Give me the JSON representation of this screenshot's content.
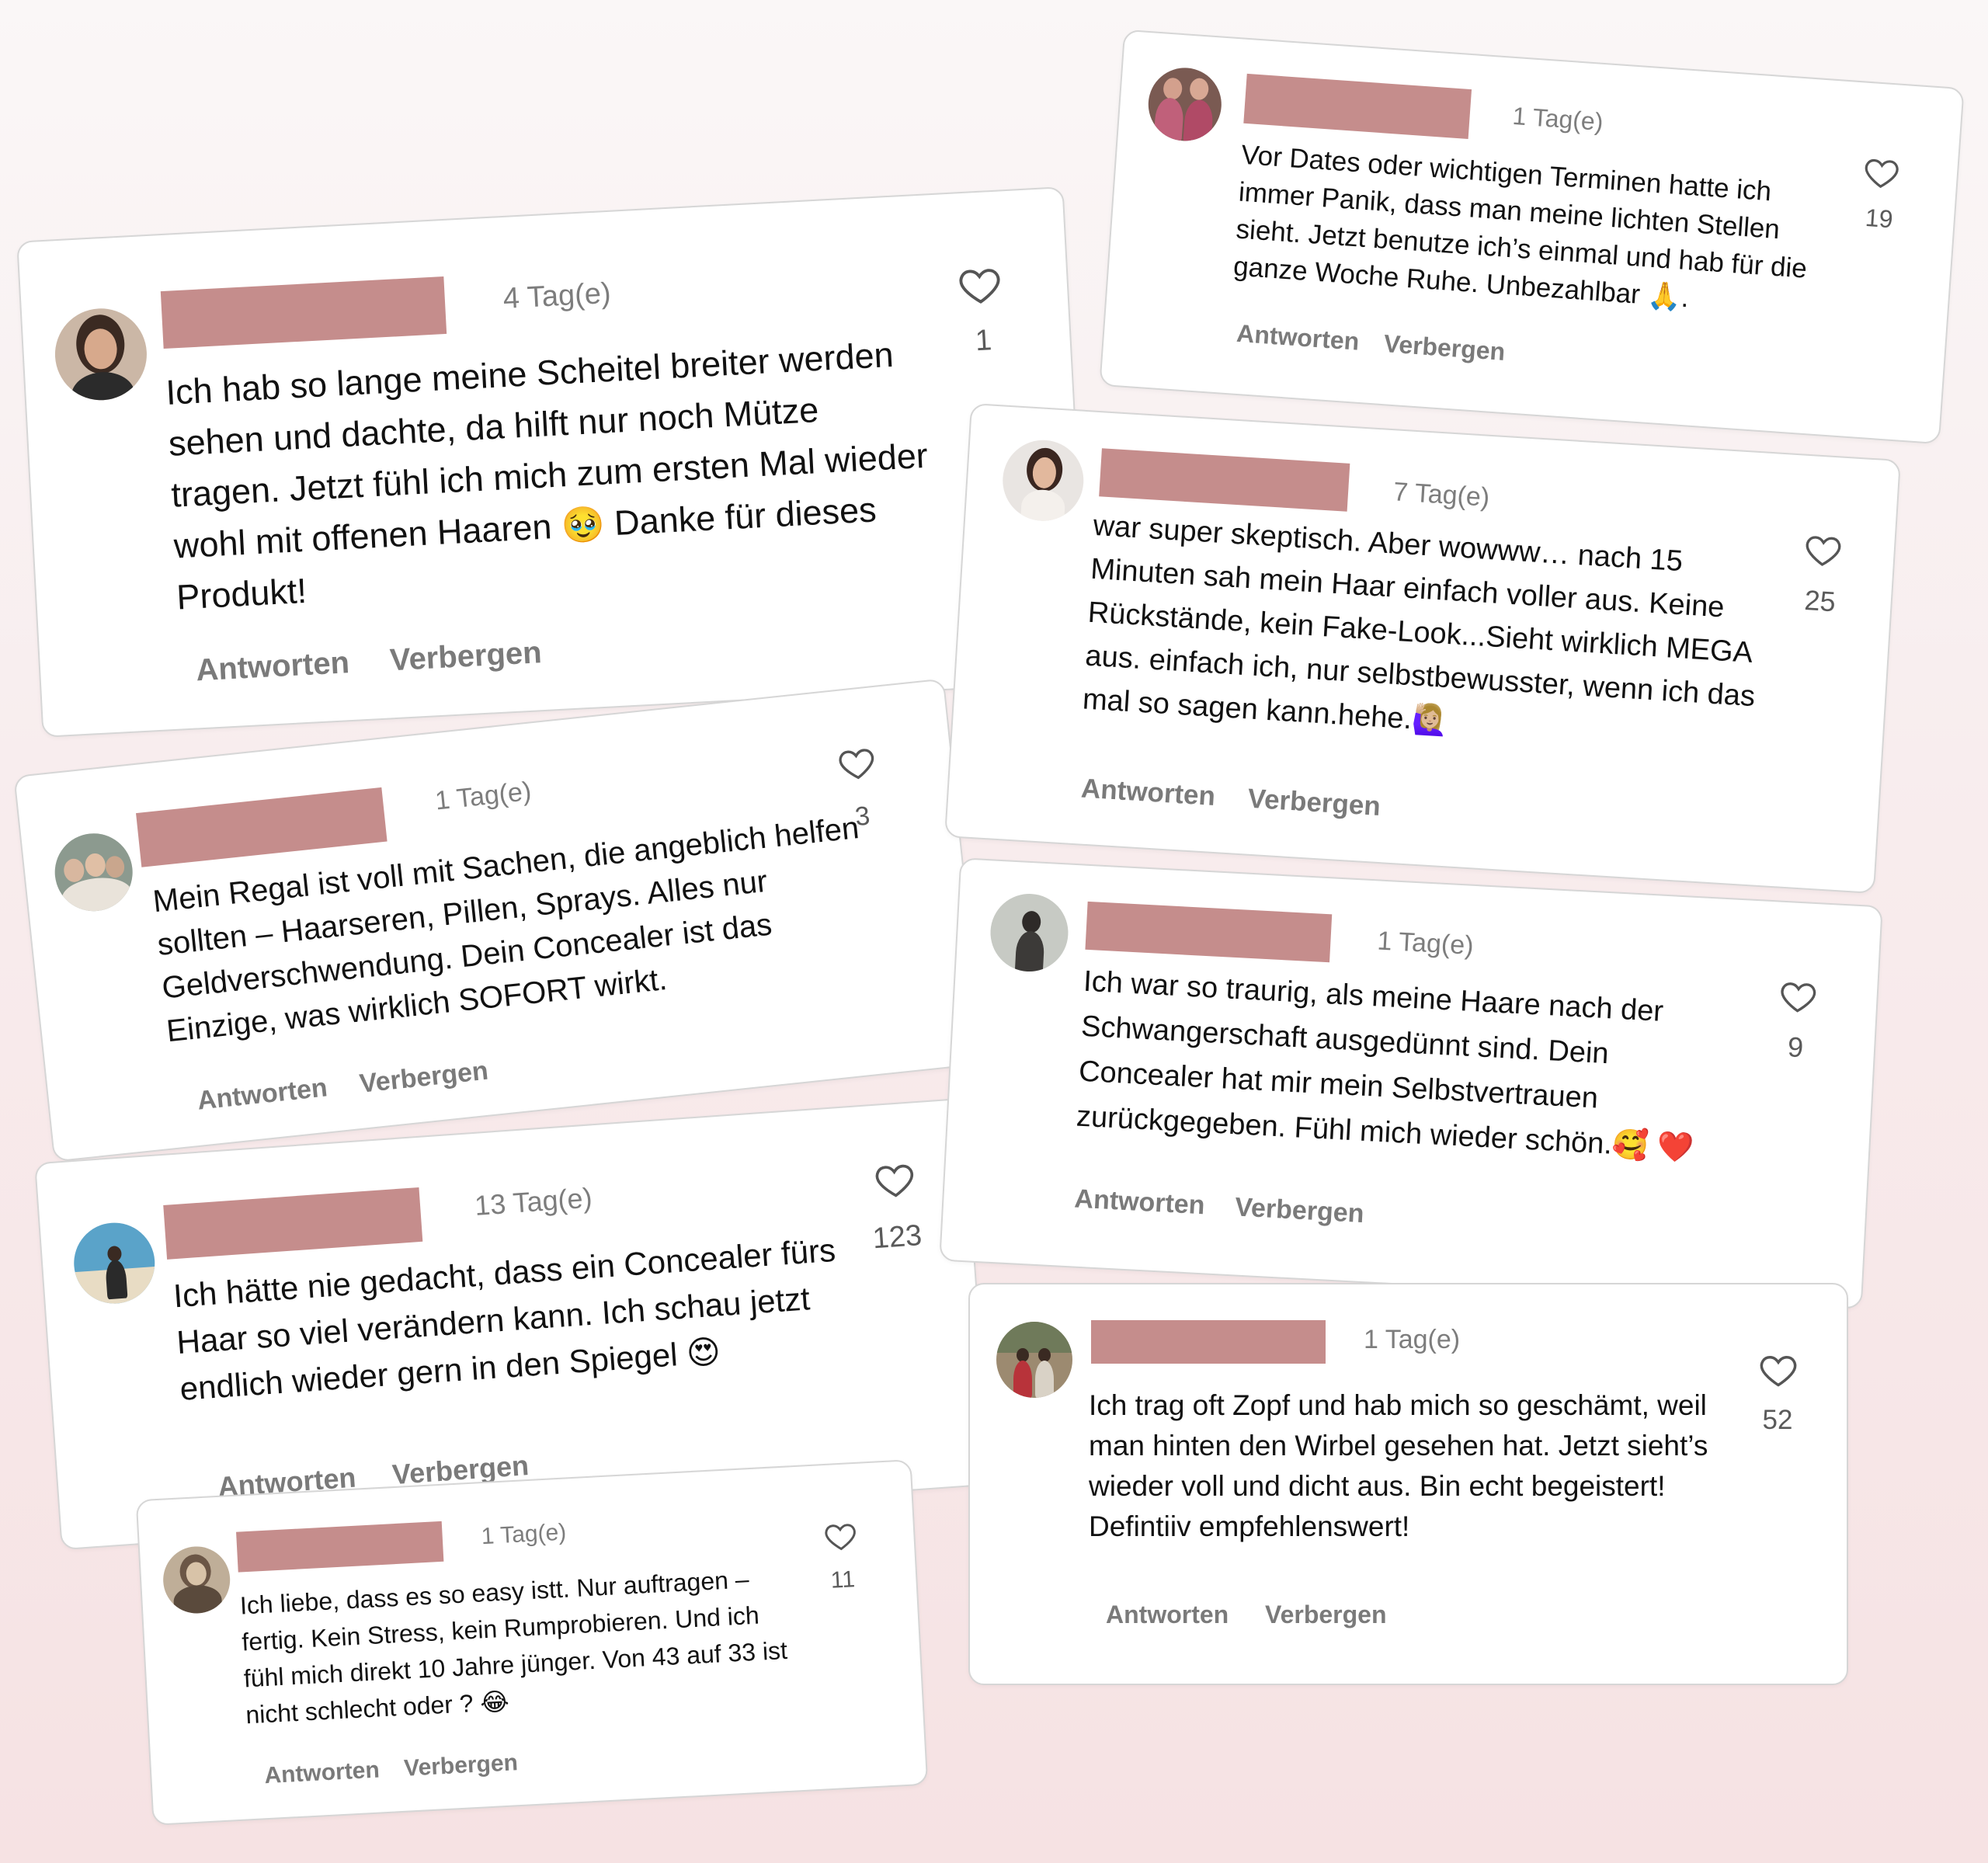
{
  "actions": {
    "reply": "Antworten",
    "hide": "Verbergen"
  },
  "colors": {
    "name_bar": "#c58d8c",
    "background_top": "#faf7f7",
    "background_bottom": "#f6e2e3"
  },
  "icons": {
    "like": "heart-outline-icon"
  },
  "comments": [
    {
      "time": "4 Tag(e)",
      "text": "Ich hab so lange meine Scheitel breiter werden sehen und dachte, da hilft nur noch Mütze tragen. Jetzt fühl ich mich zum ersten Mal wieder wohl mit offenen Haaren 🥹 Danke für dieses Produkt!",
      "likes": "1"
    },
    {
      "time": "1 Tag(e)",
      "text": "Mein Regal ist voll mit Sachen, die angeblich helfen sollten – Haarseren, Pillen, Sprays. Alles nur Geldverschwendung. Dein Concealer ist das Einzige, was wirklich SOFORT wirkt.",
      "likes": "3"
    },
    {
      "time": "13 Tag(e)",
      "text": "Ich hätte nie gedacht, dass ein Concealer fürs Haar so viel verändern kann. Ich schau jetzt endlich wieder gern in den Spiegel 😍",
      "likes": "123"
    },
    {
      "time": "1 Tag(e)",
      "text": "Ich liebe, dass es so easy istt. Nur auftragen – fertig. Kein Stress, kein Rumprobieren. Und ich fühl mich direkt 10 Jahre jünger. Von 43 auf 33 ist nicht schlecht oder ? 😂",
      "likes": "11"
    },
    {
      "time": "1 Tag(e)",
      "text": "Vor Dates oder wichtigen Terminen hatte ich immer Panik, dass man meine lichten Stellen sieht. Jetzt benutze ich’s einmal und hab für die ganze Woche Ruhe. Unbezahlbar 🙏.",
      "likes": "19"
    },
    {
      "time": "7 Tag(e)",
      "text": "war super skeptisch. Aber wowww… nach 15 Minuten sah mein Haar einfach voller aus. Keine Rückstände, kein Fake-Look...Sieht wirklich MEGA aus. einfach ich, nur selbstbewusster, wenn ich das mal so sagen kann.hehe.🙋🏼‍♀️",
      "likes": "25"
    },
    {
      "time": "1 Tag(e)",
      "text": "Ich war so traurig, als meine Haare nach der Schwangerschaft ausgedünnt sind. Dein Concealer hat mir mein Selbstvertrauen zurückgegeben. Fühl mich wieder schön.🥰 ❤️",
      "likes": "9"
    },
    {
      "time": "1 Tag(e)",
      "text": "Ich trag oft Zopf und hab mich so geschämt, weil man hinten den Wirbel gesehen hat. Jetzt sieht’s wieder voll und dicht aus. Bin echt begeistert! Defintiiv empfehlenswert!",
      "likes": "52"
    }
  ]
}
